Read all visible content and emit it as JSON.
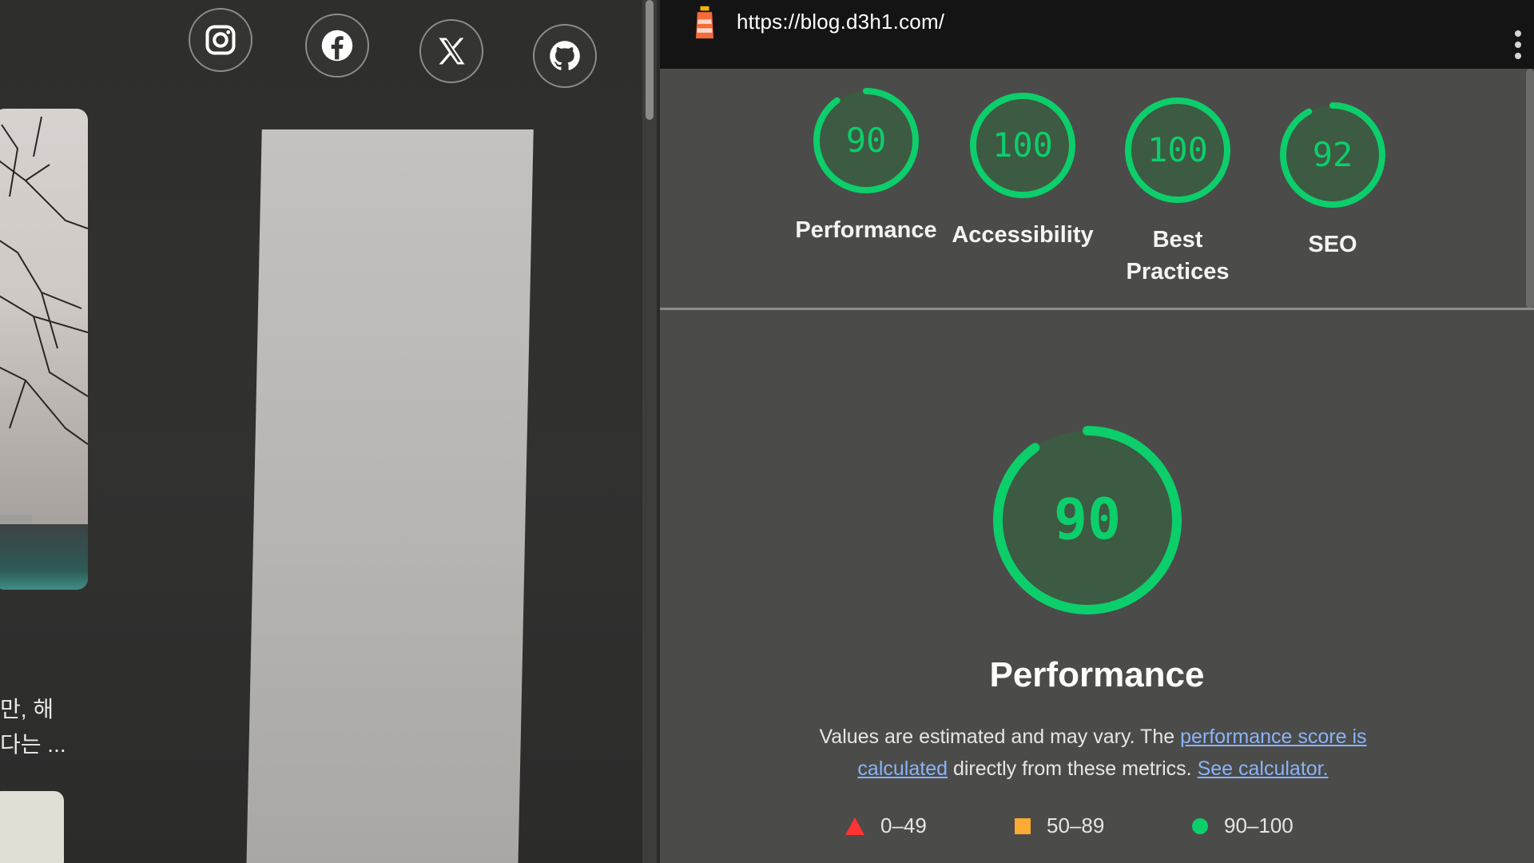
{
  "social": [
    {
      "name": "instagram",
      "icon": "instagram-icon"
    },
    {
      "name": "facebook",
      "icon": "facebook-icon"
    },
    {
      "name": "x",
      "icon": "x-icon"
    },
    {
      "name": "github",
      "icon": "github-icon"
    }
  ],
  "blog": {
    "snippet_line1": "만, 해",
    "snippet_line2": "다는 ..."
  },
  "lighthouse": {
    "url": "https://blog.d3h1.com/",
    "categories": [
      {
        "score": "90",
        "label": "Performance",
        "fraction": 0.9
      },
      {
        "score": "100",
        "label": "Accessibility",
        "fraction": 1.0
      },
      {
        "score": "100",
        "label": "Best Practices",
        "fraction": 1.0
      },
      {
        "score": "92",
        "label": "SEO",
        "fraction": 0.92
      }
    ],
    "main": {
      "score": "90",
      "title": "Performance",
      "fraction": 0.9
    },
    "description": {
      "text1": "Values are estimated and may vary. The ",
      "link1": "performance score is calculated",
      "text2": " directly from these metrics. ",
      "link2": "See calculator."
    },
    "legend": [
      {
        "range": "0–49",
        "shape": "triangle",
        "color": "#ff3333"
      },
      {
        "range": "50–89",
        "shape": "square",
        "color": "#ffaa33"
      },
      {
        "range": "90–100",
        "shape": "circle",
        "color": "#0cce6b"
      }
    ],
    "colors": {
      "pass": "#0cce6b",
      "pass_fill": "#3d5a42"
    }
  }
}
